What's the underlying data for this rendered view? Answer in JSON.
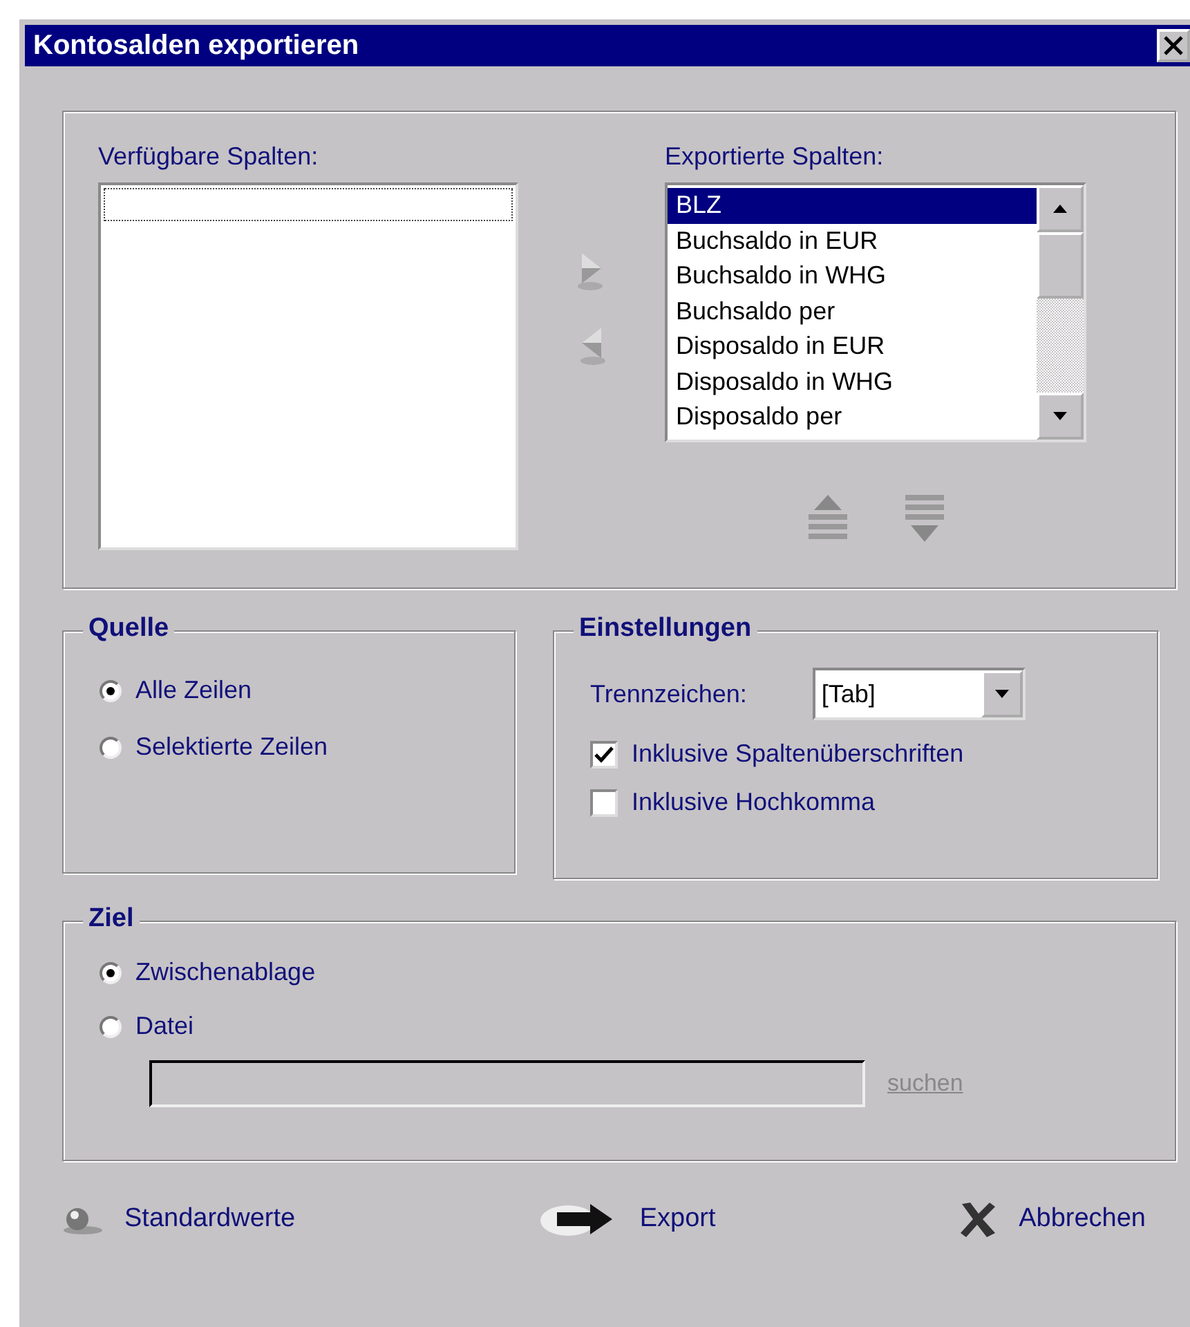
{
  "window": {
    "title": "Kontosalden exportieren"
  },
  "available_columns": {
    "label": "Verfügbare Spalten:",
    "focused": true
  },
  "exported_columns": {
    "label": "Exportierte Spalten:",
    "items": [
      {
        "text": "BLZ",
        "selected": true
      },
      {
        "text": "Buchsaldo in EUR",
        "selected": false
      },
      {
        "text": "Buchsaldo in WHG",
        "selected": false
      },
      {
        "text": "Buchsaldo per",
        "selected": false
      },
      {
        "text": "Disposaldo in EUR",
        "selected": false
      },
      {
        "text": "Disposaldo in WHG",
        "selected": false
      },
      {
        "text": "Disposaldo per",
        "selected": false
      }
    ]
  },
  "source": {
    "title": "Quelle",
    "options": [
      {
        "label": "Alle Zeilen",
        "selected": true
      },
      {
        "label": "Selektierte Zeilen",
        "selected": false
      }
    ]
  },
  "settings": {
    "title": "Einstellungen",
    "separator": {
      "label": "Trennzeichen:",
      "value": "[Tab]"
    },
    "checkboxes": [
      {
        "label": "Inklusive Spaltenüberschriften",
        "checked": true
      },
      {
        "label": "Inklusive Hochkomma",
        "checked": false
      }
    ]
  },
  "target": {
    "title": "Ziel",
    "options": [
      {
        "label": "Zwischenablage",
        "selected": true
      },
      {
        "label": "Datei",
        "selected": false
      }
    ],
    "file_field": {
      "disabled": true
    },
    "browse_link": {
      "text": "suchen",
      "disabled": true
    }
  },
  "buttons": [
    {
      "label": "Standardwerte",
      "kind": "defaults"
    },
    {
      "label": "Export",
      "kind": "export"
    },
    {
      "label": "Abbrechen",
      "kind": "cancel"
    }
  ]
}
